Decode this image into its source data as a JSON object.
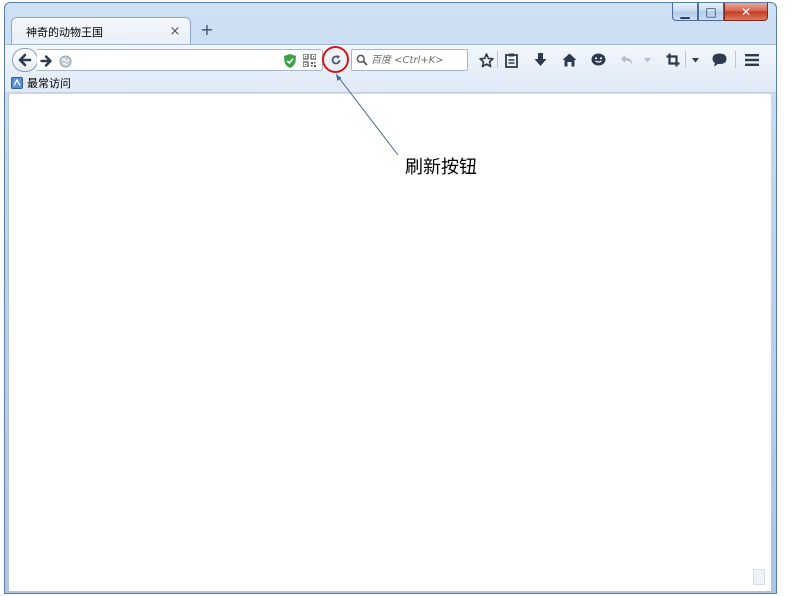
{
  "window": {
    "caption_buttons": {
      "minimize_glyph": "▁",
      "maximize_glyph": "□",
      "close_glyph": "✕"
    },
    "tab": {
      "title": "神奇的动物王国",
      "close_glyph": "×"
    },
    "new_tab_glyph": "+"
  },
  "nav": {
    "url_value": "",
    "search_placeholder": "百度 <Ctrl+K>"
  },
  "bookmarks": {
    "items": [
      {
        "label": "最常访问",
        "icon": "bookmark-folder-icon"
      }
    ]
  },
  "annotation": {
    "label": "刷新按钮",
    "color": "#d01818"
  },
  "colors": {
    "titlebar": "#bcd3ee",
    "toolbar": "#e6eef8",
    "close_button": "#c43b22",
    "shield_green": "#3aa34a"
  }
}
